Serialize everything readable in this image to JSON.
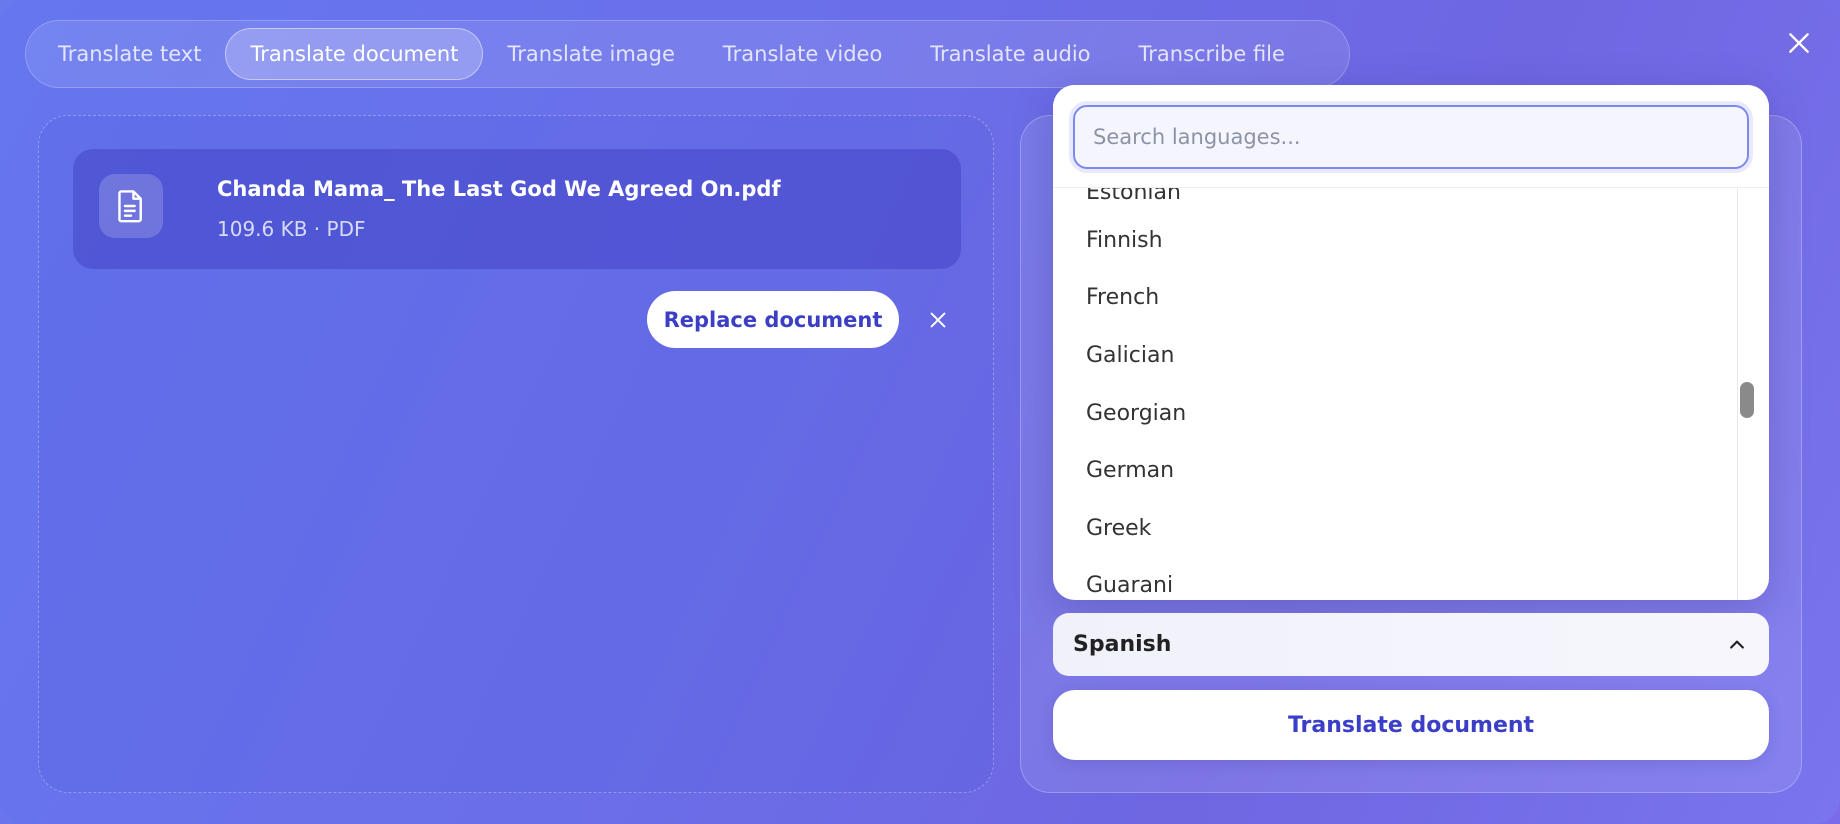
{
  "tabs": [
    {
      "label": "Translate text",
      "active": false
    },
    {
      "label": "Translate document",
      "active": true
    },
    {
      "label": "Translate image",
      "active": false
    },
    {
      "label": "Translate video",
      "active": false
    },
    {
      "label": "Translate audio",
      "active": false
    },
    {
      "label": "Transcribe file",
      "active": false
    }
  ],
  "file": {
    "name": "Chanda Mama_ The Last God We Agreed On.pdf",
    "meta": "109.6 KB · PDF",
    "icon": "document-icon"
  },
  "actions": {
    "replace_label": "Replace document",
    "translate_label": "Translate document"
  },
  "language_dropdown": {
    "search_placeholder": "Search languages...",
    "items": [
      "Estonian",
      "Finnish",
      "French",
      "Galician",
      "Georgian",
      "German",
      "Greek",
      "Guarani"
    ]
  },
  "selected_language": "Spanish",
  "colors": {
    "accent": "#3b3fc8",
    "background": "#6a72ec",
    "search_border": "#7d88f0"
  }
}
